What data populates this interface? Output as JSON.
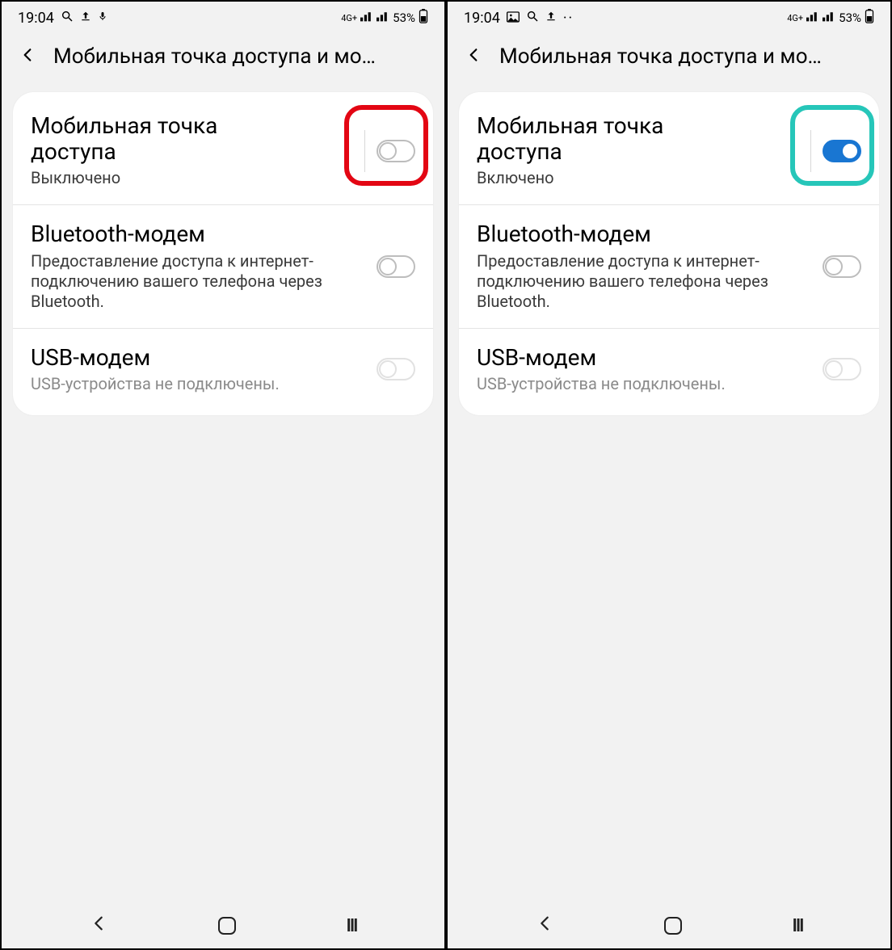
{
  "highlight_colors": {
    "off": "#e30613",
    "on": "#26c6b9"
  },
  "screens": [
    {
      "status": {
        "time": "19:04",
        "left_icons": [
          "search",
          "upload",
          "mic"
        ],
        "net_label": "4G+",
        "battery_pct": "53%"
      },
      "header": {
        "title": "Мобильная точка доступа и мо…"
      },
      "hotspot": {
        "title": "Мобильная точка\nдоступа",
        "subtitle": "Выключено",
        "on": false,
        "highlight": "red"
      },
      "bluetooth": {
        "title": "Bluetooth-модем",
        "subtitle": "Предоставление доступа к интернет-подключению вашего телефона через Bluetooth.",
        "on": false
      },
      "usb": {
        "title": "USB-модем",
        "subtitle": "USB-устройства не подключены.",
        "on": false,
        "disabled": true
      }
    },
    {
      "status": {
        "time": "19:04",
        "left_icons": [
          "image",
          "search",
          "upload",
          "dots"
        ],
        "net_label": "4G+",
        "battery_pct": "53%"
      },
      "header": {
        "title": "Мобильная точка доступа и мо…"
      },
      "hotspot": {
        "title": "Мобильная точка\nдоступа",
        "subtitle": "Включено",
        "on": true,
        "highlight": "teal"
      },
      "bluetooth": {
        "title": "Bluetooth-модем",
        "subtitle": "Предоставление доступа к интернет-подключению вашего телефона через Bluetooth.",
        "on": false
      },
      "usb": {
        "title": "USB-модем",
        "subtitle": "USB-устройства не подключены.",
        "on": false,
        "disabled": true
      }
    }
  ]
}
